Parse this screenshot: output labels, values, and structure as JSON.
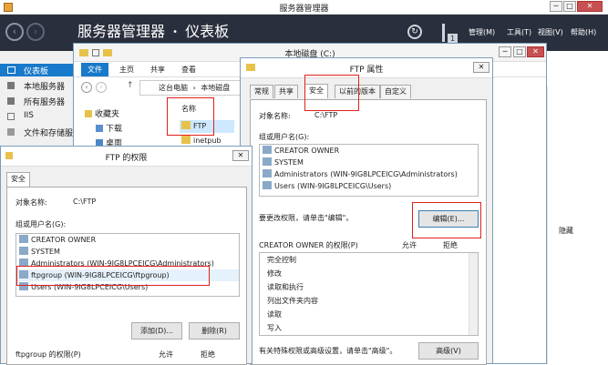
{
  "server_manager": {
    "title": "服务器管理器",
    "breadcrumb_app": "服务器管理器",
    "breadcrumb_sep": "•",
    "breadcrumb_page": "仪表板",
    "flag_count": "1",
    "menus": [
      "管理(M)",
      "工具(T)",
      "视图(V)",
      "帮助(H)"
    ],
    "nav": [
      "仪表板",
      "本地服务器",
      "所有服务器",
      "IIS",
      "文件和存储服"
    ],
    "hide_label": "隐藏"
  },
  "explorer": {
    "title": "本地磁盘 (C:)",
    "ribbon_tabs": [
      "文件",
      "主页",
      "共享",
      "查看"
    ],
    "address": [
      "这台电脑",
      "本地磁盘"
    ],
    "address_sep": "›",
    "tree": [
      "收藏夹",
      "下载",
      "桌面"
    ],
    "column_name": "名称",
    "files": [
      "FTP",
      "inetpub"
    ]
  },
  "ftp_props": {
    "title": "FTP 属性",
    "tabs": [
      "常规",
      "共享",
      "安全",
      "以前的版本",
      "自定义"
    ],
    "object_label": "对象名称:",
    "object_value": "C:\\FTP",
    "group_label": "组或用户名(G):",
    "users": [
      "CREATOR OWNER",
      "SYSTEM",
      "Administrators (WIN-9IG8LPCEICG\\Administrators)",
      "Users (WIN-9IG8LPCEICG\\Users)"
    ],
    "change_hint": "要更改权限，请单击\"编辑\"。",
    "edit_button": "编辑(E)...",
    "perm_header": "CREATOR OWNER 的权限(P)",
    "allow": "允许",
    "deny": "拒绝",
    "perms": [
      "完全控制",
      "修改",
      "读取和执行",
      "列出文件夹内容",
      "读取",
      "写入"
    ],
    "special_hint": "有关特殊权限或高级设置，请单击\"高级\"。",
    "advanced_button": "高级(V)"
  },
  "ftp_perms": {
    "title": "FTP 的权限",
    "tab": "安全",
    "object_label": "对象名称:",
    "object_value": "C:\\FTP",
    "group_label": "组或用户名(G):",
    "users": [
      "CREATOR OWNER",
      "SYSTEM",
      "Administrators (WIN-9IG8LPCEICG\\Administrators)",
      "ftpgroup (WIN-9IG8LPCEICG\\ftpgroup)",
      "Users (WIN-9IG8LPCEICG\\Users)"
    ],
    "add_button": "添加(D)...",
    "remove_button": "删除(R)",
    "perm_header": "ftpgroup 的权限(P)",
    "allow": "允许",
    "deny": "拒绝"
  },
  "colors": {
    "server_header": "#2a2f3d",
    "accent": "#1979ca",
    "highlight": "#e0201c"
  }
}
